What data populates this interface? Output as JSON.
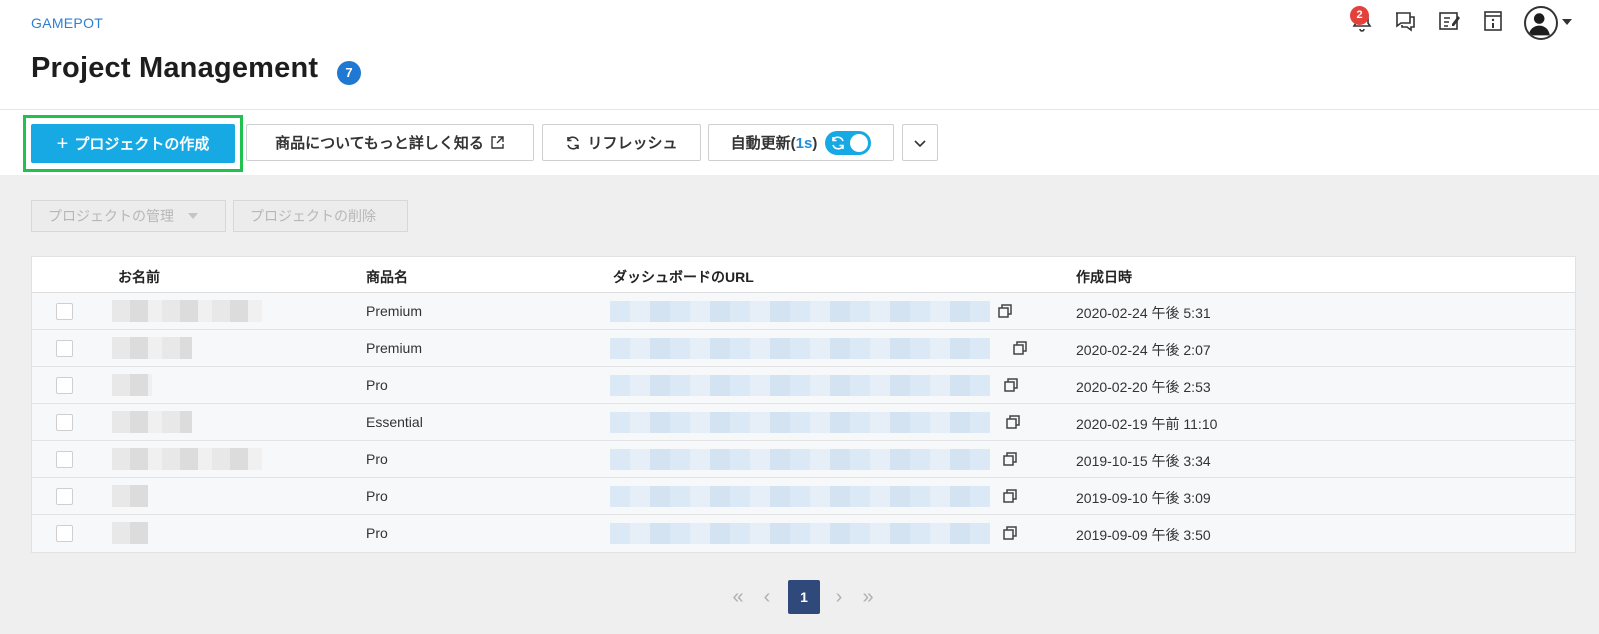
{
  "header": {
    "brand": "GAMEPOT",
    "title": "Project Management",
    "title_count": "7",
    "notifications_count": "2"
  },
  "toolbar": {
    "create_label": "プロジェクトの作成",
    "learn_label": "商品についてもっと詳しく知る",
    "refresh_label": "リフレッシュ",
    "auto_label_prefix": "自動更新(",
    "auto_interval": "1s",
    "auto_label_suffix": ")"
  },
  "actions": {
    "manage_label": "プロジェクトの管理",
    "delete_label": "プロジェクトの削除"
  },
  "table": {
    "columns": [
      "お名前",
      "商品名",
      "ダッシュボードのURL",
      "作成日時"
    ],
    "rows": [
      {
        "product": "Premium",
        "created": "2020-02-24 午後 5:31"
      },
      {
        "product": "Premium",
        "created": "2020-02-24 午後 2:07"
      },
      {
        "product": "Pro",
        "created": "2020-02-20 午後 2:53"
      },
      {
        "product": "Essential",
        "created": "2020-02-19 午前 11:10"
      },
      {
        "product": "Pro",
        "created": "2019-10-15 午後 3:34"
      },
      {
        "product": "Pro",
        "created": "2019-09-10 午後 3:09"
      },
      {
        "product": "Pro",
        "created": "2019-09-09 午後 3:50"
      }
    ]
  },
  "pagination": {
    "current_page": "1"
  },
  "colors": {
    "accent": "#17a9e3",
    "brand_link": "#2d7fd0",
    "badge_red": "#e5413b",
    "highlight_border": "#1fc24d",
    "page_active": "#2f4a7a"
  }
}
